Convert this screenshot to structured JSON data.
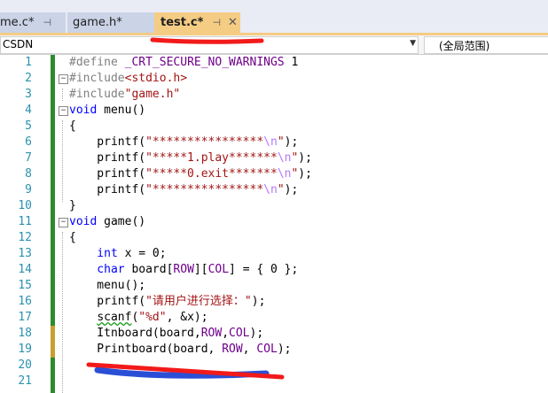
{
  "tabs": [
    {
      "label": "me.c*",
      "pin": "⊣"
    },
    {
      "label": "game.h*",
      "pin": ""
    },
    {
      "label": "test.c*",
      "pin": "⊣",
      "close": "✕"
    }
  ],
  "navbar": {
    "scope_value": "CSDN",
    "member_value": "(全局范围)"
  },
  "line_numbers": [
    "1",
    "2",
    "3",
    "4",
    "5",
    "6",
    "7",
    "8",
    "9",
    "10",
    "11",
    "12",
    "13",
    "14",
    "15",
    "16",
    "17",
    "18",
    "19",
    "20",
    "21"
  ],
  "code": {
    "l1a": "#define ",
    "l1b": "_CRT_SECURE_NO_WARNINGS",
    "l1c": " 1",
    "l2a": "#include",
    "l2b": "<stdio.h>",
    "l3a": "#include",
    "l3b": "\"game.h\"",
    "l4a": "void",
    "l4b": " menu()",
    "l5": "{",
    "l6a": "    printf(",
    "l6b": "\"****************",
    "l6c": "\\n",
    "l6d": "\"",
    "l6e": ");",
    "l7a": "    printf(",
    "l7b": "\"*****1.play*******",
    "l7c": "\\n",
    "l7d": "\"",
    "l7e": ");",
    "l8a": "    printf(",
    "l8b": "\"*****0.exit*******",
    "l8c": "\\n",
    "l8d": "\"",
    "l8e": ");",
    "l9a": "    printf(",
    "l9b": "\"****************",
    "l9c": "\\n",
    "l9d": "\"",
    "l9e": ");",
    "l10": "}",
    "l11a": "void",
    "l11b": " game()",
    "l12": "{",
    "l13a": "    int",
    "l13b": " x = 0;",
    "l14a": "    char",
    "l14b": " board[",
    "l14c": "ROW",
    "l14d": "][",
    "l14e": "COL",
    "l14f": "] = { 0 };",
    "l15": "    menu();",
    "l16a": "    printf(",
    "l16b": "\"请用户进行选择：\"",
    "l16c": ");",
    "l17a": "    ",
    "l17b": "scanf",
    "l17c": "(",
    "l17d": "\"%d\"",
    "l17e": ", &x);",
    "l18a": "    Itnboard(board,",
    "l18b": "ROW",
    "l18c": ",",
    "l18d": "COL",
    "l18e": ");",
    "l19a": "    Printboard(board, ",
    "l19b": "ROW",
    "l19c": ", ",
    "l19d": "COL",
    "l19e": ");"
  },
  "colors": {
    "keyword": "#0000ff",
    "string": "#a31515",
    "preprocessor": "#808080",
    "macro": "#6f008a",
    "line_number": "#2b91af",
    "change_saved": "#2e8b2e",
    "change_unsaved": "#c8a030",
    "active_tab": "#f5cc84"
  }
}
